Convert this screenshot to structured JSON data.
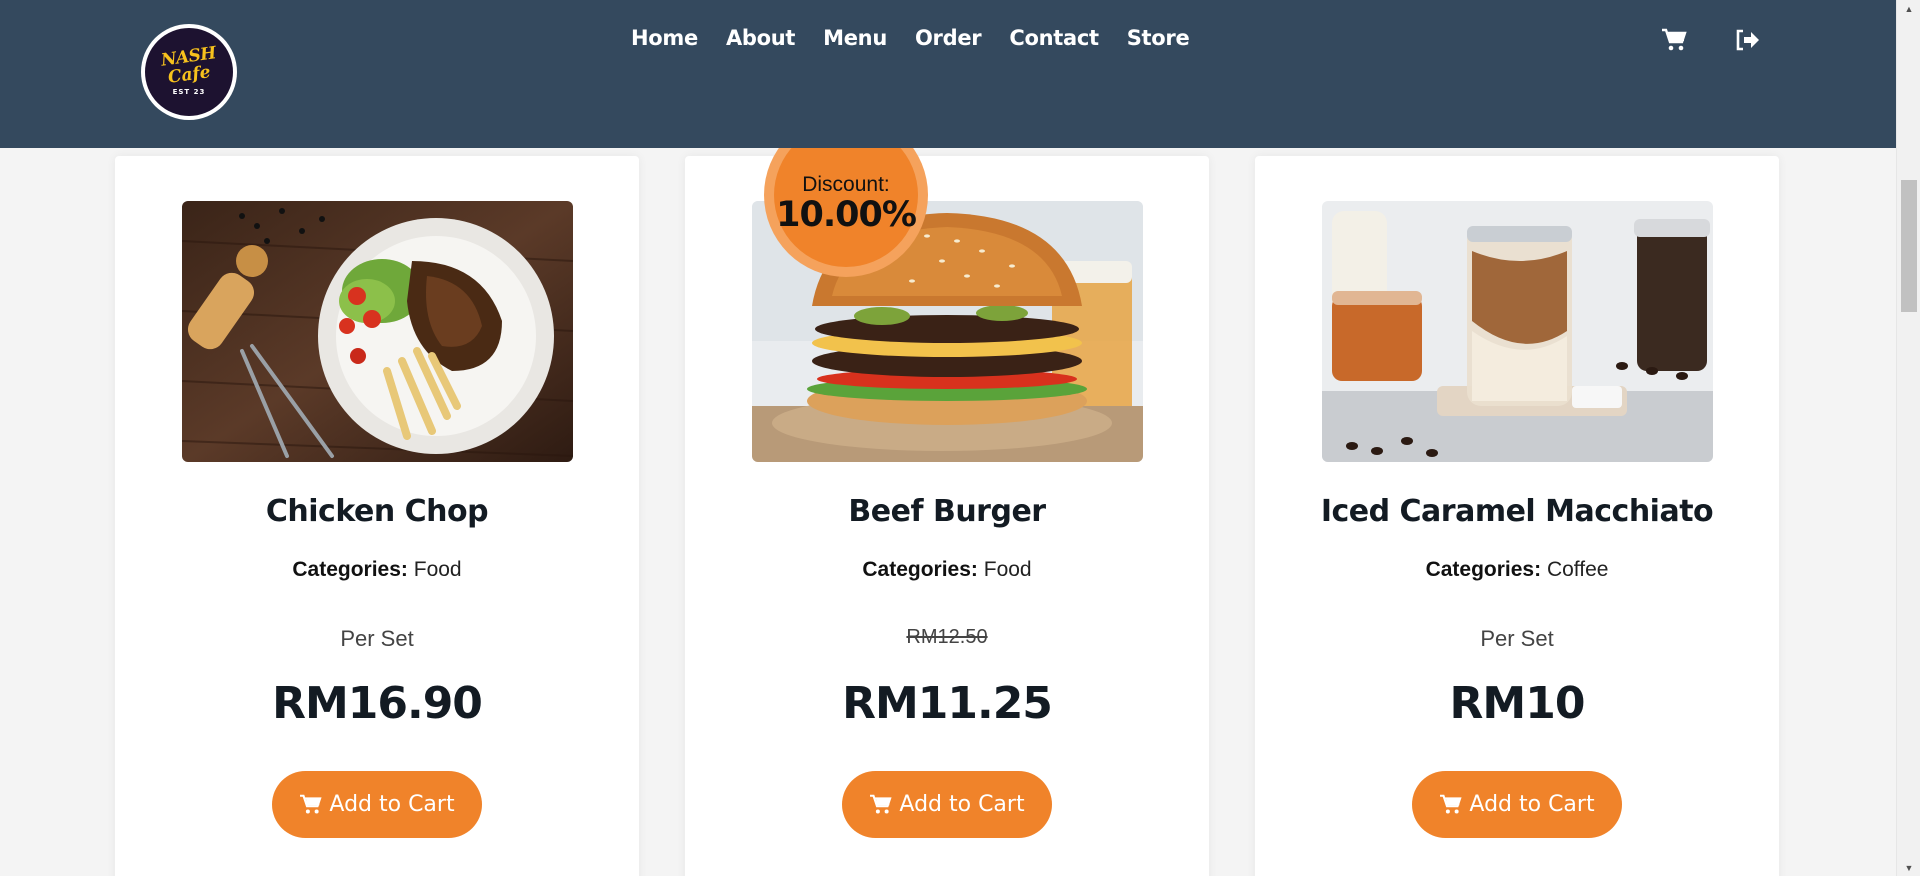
{
  "brand": {
    "logo_lines": [
      "NASH",
      "Cafe",
      "EST 23"
    ]
  },
  "nav": {
    "links": [
      "Home",
      "About",
      "Menu",
      "Order",
      "Contact",
      "Store"
    ],
    "icons": [
      "shopping-cart-icon",
      "sign-out-icon"
    ]
  },
  "discount": {
    "label": "Discount:",
    "value": "10.00%"
  },
  "products": [
    {
      "name": "Chicken Chop",
      "categories_label": "Categories:",
      "category": "Food",
      "subtext": "Per Set",
      "price": "RM16.90",
      "button_label": "Add to Cart"
    },
    {
      "name": "Beef Burger",
      "categories_label": "Categories:",
      "category": "Food",
      "subtext": "RM12.50",
      "price": "RM11.25",
      "button_label": "Add to Cart"
    },
    {
      "name": "Iced Caramel Macchiato",
      "categories_label": "Categories:",
      "category": "Coffee",
      "subtext": "Per Set",
      "price": "RM10",
      "button_label": "Add to Cart"
    }
  ],
  "colors": {
    "navbar": "#34495e",
    "accent": "#f0832a",
    "text_dark": "#131b23"
  }
}
